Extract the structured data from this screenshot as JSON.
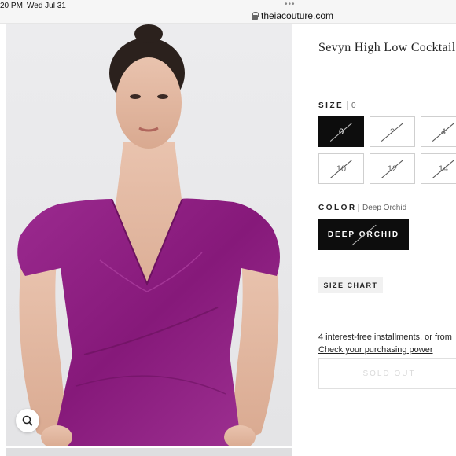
{
  "status_bar": {
    "time": "20 PM",
    "date": "Wed Jul 31",
    "url": "theiacouture.com"
  },
  "product": {
    "title": "Sevyn High Low Cocktail D",
    "size_label": "SIZE",
    "size_selected": "0",
    "sizes": [
      {
        "label": "0",
        "selected": true,
        "available": false
      },
      {
        "label": "2",
        "selected": false,
        "available": false
      },
      {
        "label": "4",
        "selected": false,
        "available": false
      },
      {
        "label": "10",
        "selected": false,
        "available": false
      },
      {
        "label": "12",
        "selected": false,
        "available": false
      },
      {
        "label": "14",
        "selected": false,
        "available": false
      }
    ],
    "color_label": "COLOR",
    "color_selected": "Deep Orchid",
    "color_button": "DEEP ORCHID",
    "size_chart": "SIZE CHART",
    "installments_text": "4 interest-free installments, or from",
    "purchasing_power_link": "Check your purchasing power",
    "sold_out": "SOLD OUT"
  },
  "colors": {
    "dress": "#8e1f82",
    "selected_bg": "#0d0d0d"
  },
  "icons": {
    "zoom": "magnifier-icon",
    "lock": "lock-icon"
  }
}
